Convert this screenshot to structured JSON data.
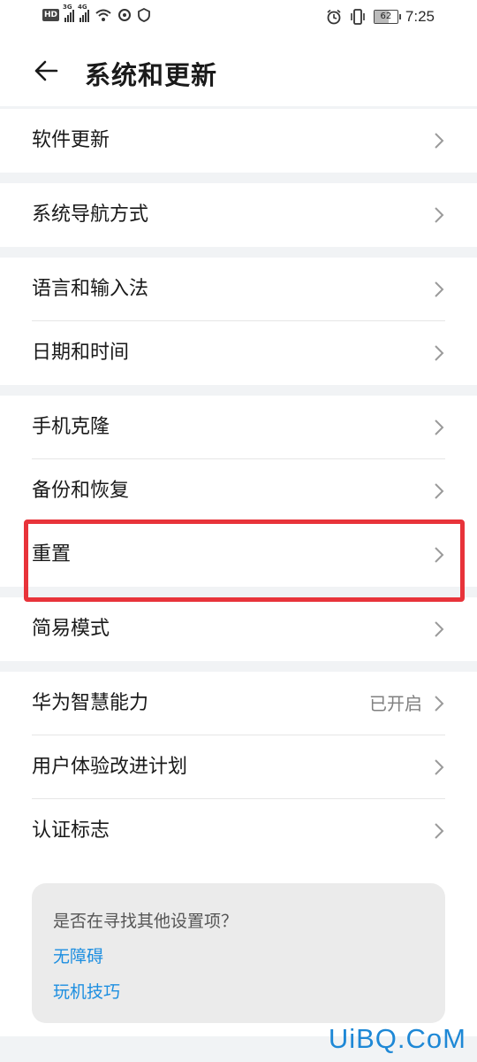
{
  "status_bar": {
    "left_icons": [
      "hd-icon",
      "signal-3g-icon",
      "signal-4g-icon",
      "wifi-icon",
      "sync-icon",
      "shield-icon"
    ],
    "signal_tags": [
      "3G",
      "4G"
    ],
    "hd_label": "HD",
    "right_icons": [
      "alarm-icon",
      "vibrate-icon",
      "battery-icon"
    ],
    "battery_level": "62",
    "time": "7:25"
  },
  "header": {
    "title": "系统和更新",
    "back_icon": "arrow-left-icon"
  },
  "groups": [
    {
      "items": [
        {
          "label": "软件更新"
        }
      ]
    },
    {
      "items": [
        {
          "label": "系统导航方式"
        }
      ]
    },
    {
      "items": [
        {
          "label": "语言和输入法"
        },
        {
          "label": "日期和时间"
        }
      ]
    },
    {
      "items": [
        {
          "label": "手机克隆"
        },
        {
          "label": "备份和恢复"
        },
        {
          "label": "重置"
        }
      ]
    },
    {
      "items": [
        {
          "label": "简易模式"
        }
      ]
    },
    {
      "items": [
        {
          "label": "华为智慧能力",
          "value": "已开启"
        },
        {
          "label": "用户体验改进计划"
        },
        {
          "label": "认证标志"
        }
      ]
    }
  ],
  "highlight_color": "#e8333a",
  "suggestion": {
    "question": "是否在寻找其他设置项？",
    "links": [
      "无障碍",
      "玩机技巧"
    ]
  },
  "watermark": "UiBQ.CoM",
  "colors": {
    "link": "#1c8ee0",
    "background": "#f1f3f5",
    "card": "#ffffff"
  }
}
